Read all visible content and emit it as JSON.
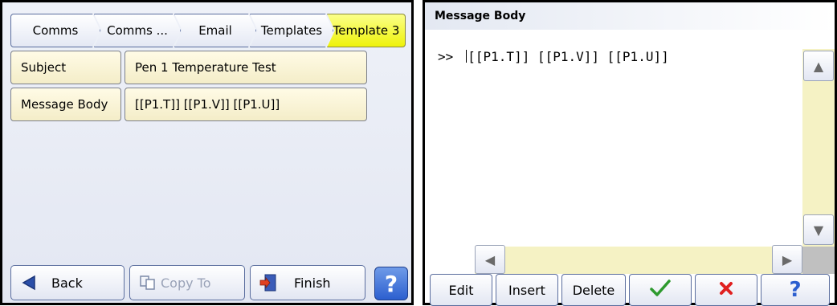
{
  "left": {
    "breadcrumb": [
      "Comms",
      "Comms ...",
      "Email",
      "Templates",
      "Template 3"
    ],
    "fields": [
      {
        "label": "Subject",
        "value": "Pen 1 Temperature Test"
      },
      {
        "label": "Message Body",
        "value": "[[P1.T]] [[P1.V]] [[P1.U]]"
      }
    ],
    "buttons": {
      "back": "Back",
      "copy_to": "Copy To",
      "finish": "Finish",
      "help": "?"
    }
  },
  "right": {
    "title": "Message Body",
    "prompt": ">>",
    "text": "[[P1.T]] [[P1.V]] [[P1.U]]",
    "buttons": {
      "edit": "Edit",
      "insert": "Insert",
      "delete": "Delete",
      "help": "?"
    }
  },
  "colors": {
    "active_crumb": "#eef20a",
    "field_bg": "#f4edc8",
    "help_blue": "#2c5fcf",
    "scroll_bg": "#f5f2c4",
    "ok_green": "#2e9a2e",
    "cancel_red": "#e02020"
  }
}
